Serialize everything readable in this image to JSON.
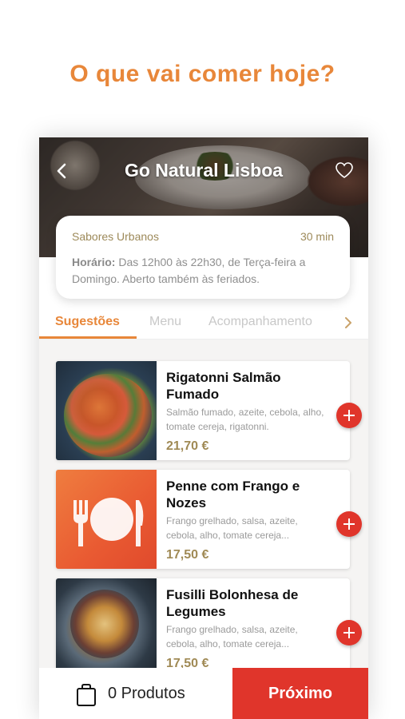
{
  "headline": "O que vai comer hoje?",
  "colors": {
    "accent": "#e8873a",
    "primary_red": "#e0352b",
    "price": "#a08a55"
  },
  "restaurant": {
    "title": "Go Natural Lisboa",
    "category": "Sabores Urbanos",
    "delivery_time": "30 min",
    "hours_label": "Horário:",
    "hours_text": "Das 12h00 às 22h30, de Terça-feira a Domingo. Aberto também às feriados."
  },
  "tabs": [
    {
      "label": "Sugestões",
      "active": true
    },
    {
      "label": "Menu",
      "active": false
    },
    {
      "label": "Acompanhamento",
      "active": false
    }
  ],
  "items": [
    {
      "name": "Rigatonni Salmão Fumado",
      "description": "Salmão fumado, azeite, cebola, alho, tomate cereja, rigatonni.",
      "price": "21,70 €",
      "image": "pasta-photo"
    },
    {
      "name": "Penne com Frango e Nozes",
      "description": "Frango grelhado, salsa, azeite, cebola, alho, tomate cereja...",
      "price": "17,50 €",
      "image": "plate-placeholder-icon"
    },
    {
      "name": "Fusilli Bolonhesa de Legumes",
      "description": "Frango grelhado, salsa, azeite, cebola, alho, tomate cereja...",
      "price": "17,50 €",
      "image": "fusilli-photo"
    }
  ],
  "bottom_bar": {
    "cart_label": "0 Produtos",
    "next_label": "Próximo"
  },
  "icons": {
    "back": "back-arrow-icon",
    "favorite": "heart-icon",
    "cart": "shopping-bag-icon",
    "add": "plus-icon",
    "tabs_more": "chevron-right-icon"
  }
}
